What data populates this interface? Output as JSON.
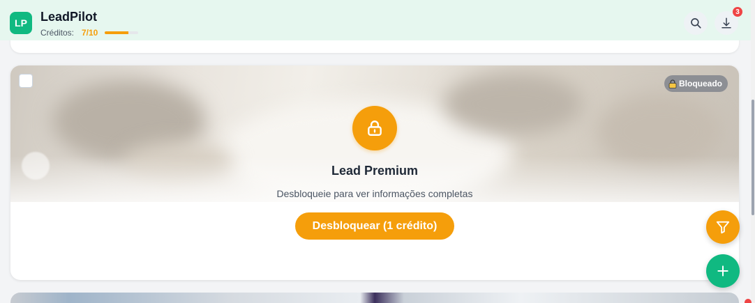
{
  "header": {
    "logo_text": "LP",
    "app_title": "LeadPilot",
    "credits_label": "Créditos:",
    "credits_value": "7/10",
    "credits_fraction": 0.7,
    "search_icon": "search-icon",
    "download_icon": "download-icon",
    "notification_count": "3"
  },
  "lead_card": {
    "locked_badge": "Bloqueado",
    "locked_badge_icon": "lock-icon",
    "lock_icon": "lock-icon",
    "title": "Lead Premium",
    "subtitle": "Desbloqueie para ver informações completas",
    "unlock_button": "Desbloquear (1 crédito)"
  },
  "fabs": {
    "filter_icon": "filter-icon",
    "add_icon": "plus-icon"
  },
  "colors": {
    "brand_green": "#10b981",
    "accent_orange": "#f59e0b",
    "badge_red": "#ef4444",
    "locked_badge_gray": "#8d8f94",
    "header_bg": "#e6f7ef"
  }
}
